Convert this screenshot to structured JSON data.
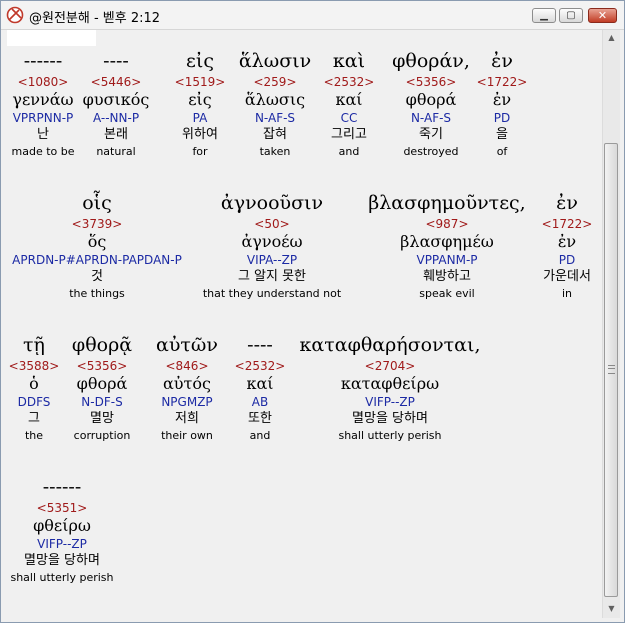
{
  "window": {
    "title": "@원전분해 - 벧후 2:12"
  },
  "rows": [
    {
      "words": [
        {
          "greek": "------",
          "strong": "<1080>",
          "lemma": "γεννάω",
          "parse": "VPRPNN-P",
          "korean": "난",
          "english": "made to be"
        },
        {
          "greek": "----",
          "strong": "<5446>",
          "lemma": "φυσικός",
          "parse": "A--NN-P",
          "korean": "본래",
          "english": "natural"
        },
        {
          "greek": "εἰς",
          "strong": "<1519>",
          "lemma": "εἰς",
          "parse": "PA",
          "korean": "위하여",
          "english": "for"
        },
        {
          "greek": "ἅλωσιν",
          "strong": "<259>",
          "lemma": "ἅλωσις",
          "parse": "N-AF-S",
          "korean": "잡혀",
          "english": "taken"
        },
        {
          "greek": "καὶ",
          "strong": "<2532>",
          "lemma": "καί",
          "parse": "CC",
          "korean": "그리고",
          "english": "and"
        },
        {
          "greek": "φθοράν,",
          "strong": "<5356>",
          "lemma": "φθορά",
          "parse": "N-AF-S",
          "korean": "죽기",
          "english": "destroyed"
        },
        {
          "greek": "ἐν",
          "strong": "<1722>",
          "lemma": "ἐν",
          "parse": "PD",
          "korean": "을",
          "english": "of"
        }
      ]
    },
    {
      "words": [
        {
          "greek": "οἷς",
          "strong": "<3739>",
          "lemma": "ὅς",
          "parse": "APRDN-P#APRDN-PAPDAN-P",
          "korean": "것",
          "english": "the things"
        },
        {
          "greek": "ἀγνοοῦσιν",
          "strong": "<50>",
          "lemma": "ἀγνοέω",
          "parse": "VIPA--ZP",
          "korean": "그 알지 못한",
          "english": "that they understand not"
        },
        {
          "greek": "βλασφημοῦντες,",
          "strong": "<987>",
          "lemma": "βλασφημέω",
          "parse": "VPPANM-P",
          "korean": "훼방하고",
          "english": "speak evil"
        },
        {
          "greek": "ἐν",
          "strong": "<1722>",
          "lemma": "ἐν",
          "parse": "PD",
          "korean": "가운데서",
          "english": "in"
        }
      ]
    },
    {
      "words": [
        {
          "greek": "τῇ",
          "strong": "<3588>",
          "lemma": "ὁ",
          "parse": "DDFS",
          "korean": "그",
          "english": "the"
        },
        {
          "greek": "φθορᾷ",
          "strong": "<5356>",
          "lemma": "φθορά",
          "parse": "N-DF-S",
          "korean": "멸망",
          "english": "corruption"
        },
        {
          "greek": "αὐτῶν",
          "strong": "<846>",
          "lemma": "αὐτός",
          "parse": "NPGMZP",
          "korean": "저희",
          "english": "their own"
        },
        {
          "greek": "----",
          "strong": "<2532>",
          "lemma": "καί",
          "parse": "AB",
          "korean": "또한",
          "english": "and"
        },
        {
          "greek": "καταφθαρήσονται,",
          "strong": "<2704>",
          "lemma": "καταφθείρω",
          "parse": "VIFP--ZP",
          "korean": "멸망을 당하며",
          "english": "shall utterly perish"
        }
      ]
    },
    {
      "words": [
        {
          "greek": "------",
          "strong": "<5351>",
          "lemma": "φθείρω",
          "parse": "VIFP--ZP",
          "korean": "멸망을 당하며",
          "english": "shall utterly perish"
        }
      ]
    }
  ]
}
